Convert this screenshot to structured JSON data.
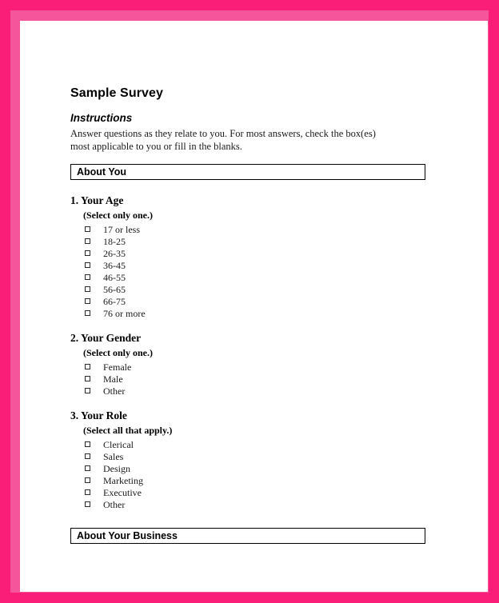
{
  "document": {
    "title": "Sample Survey",
    "instructions_heading": "Instructions",
    "instructions_body": "Answer questions as they relate to you. For most answers, check the box(es) most applicable to you or fill in the blanks."
  },
  "theme": {
    "frame_color": "#fa1e78",
    "page_color": "#ffffff",
    "text_color": "#000000",
    "rule_color": "#000000"
  },
  "sections": [
    {
      "label": "About You",
      "questions": [
        {
          "title": "1. Your Age",
          "hint": "(Select only one.)",
          "options": [
            "17 or less",
            "18-25",
            "26-35",
            "36-45",
            "46-55",
            "56-65",
            "66-75",
            "76 or more"
          ]
        },
        {
          "title": "2. Your Gender",
          "hint": "(Select only one.)",
          "options": [
            "Female",
            "Male",
            "Other"
          ]
        },
        {
          "title": "3. Your Role",
          "hint": "(Select all that apply.)",
          "options": [
            "Clerical",
            "Sales",
            "Design",
            "Marketing",
            "Executive",
            "Other"
          ]
        }
      ]
    },
    {
      "label": "About Your Business",
      "questions": []
    }
  ]
}
